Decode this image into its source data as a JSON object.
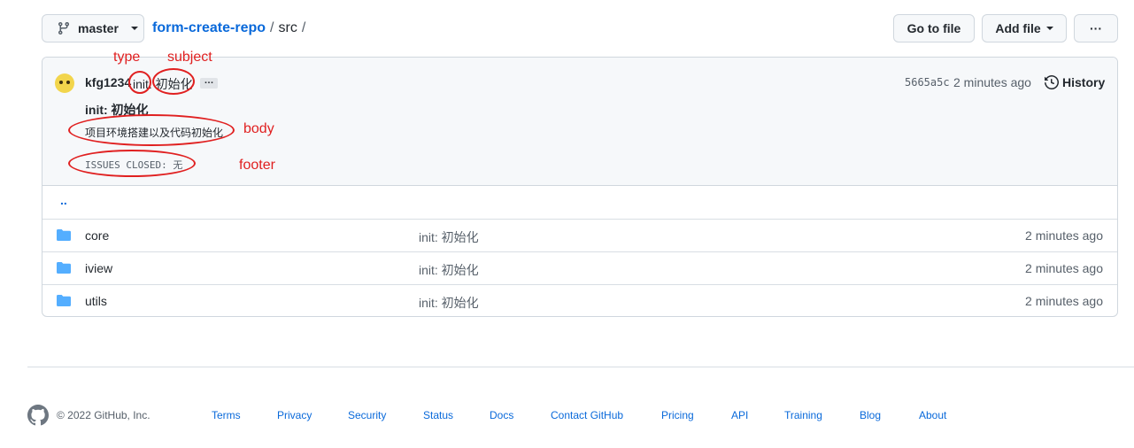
{
  "topbar": {
    "branch": "master",
    "repo": "form-create-repo",
    "sep1": "/",
    "dir": "src",
    "sep2": "/",
    "goto_label": "Go to file",
    "addfile_label": "Add file",
    "more_label": "···"
  },
  "commit": {
    "author": "kfg1234",
    "message": "init: 初始化",
    "ellipsis": "…",
    "sha": "5665a5c",
    "time": "2 minutes ago",
    "history_label": "History",
    "title": "init: 初始化",
    "body": "项目环境搭建以及代码初始化",
    "footer": "ISSUES CLOSED: 无"
  },
  "annotations": {
    "type": "type",
    "subject": "subject",
    "body": "body",
    "footer": "footer",
    "color": "#e02020"
  },
  "files": {
    "up": "..",
    "rows": [
      {
        "name": "core",
        "message": "init: 初始化",
        "time": "2 minutes ago"
      },
      {
        "name": "iview",
        "message": "init: 初始化",
        "time": "2 minutes ago"
      },
      {
        "name": "utils",
        "message": "init: 初始化",
        "time": "2 minutes ago"
      }
    ]
  },
  "footer": {
    "copyright": "© 2022 GitHub, Inc.",
    "links": [
      "Terms",
      "Privacy",
      "Security",
      "Status",
      "Docs",
      "Contact GitHub",
      "Pricing",
      "API",
      "Training",
      "Blog",
      "About"
    ]
  },
  "colors": {
    "link": "#0969da",
    "folder": "#54aeff",
    "annotation": "#e02020"
  }
}
